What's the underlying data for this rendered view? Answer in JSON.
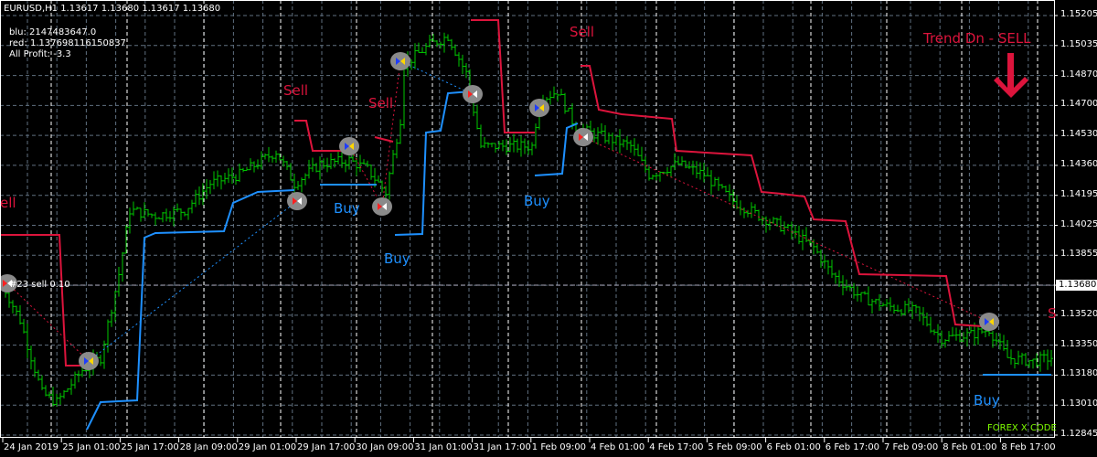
{
  "header": {
    "symbol_line": "EURUSD,H1  1.13617 1.13680 1.13617 1.13680"
  },
  "info": {
    "blu": "blu: 2147483647.0",
    "red": "red: 1.137698116150837",
    "profit": "All Profit: -3.3"
  },
  "trade_label": "#23 sell 0.10",
  "trend_label": "Trend Dn - SELL",
  "watermark": "FOREX X CODE",
  "current_price": "1.13680",
  "signals": {
    "sell": "Sell",
    "sell_cut": "ell",
    "s_cut": "S",
    "buy": "Buy"
  },
  "colors": {
    "bars": "#00c800",
    "sell_line": "#dc143c",
    "buy_line": "#1e90ff",
    "grid": "#607080"
  },
  "chart_data": {
    "type": "line",
    "title": "EURUSD,H1",
    "ylim": [
      1.12845,
      1.15205
    ],
    "yticks": [
      "1.15205",
      "1.15035",
      "1.14870",
      "1.14700",
      "1.14530",
      "1.14360",
      "1.14195",
      "1.14025",
      "1.13855",
      "1.13680",
      "1.13520",
      "1.13350",
      "1.13180",
      "1.13010",
      "1.12845"
    ],
    "xticks": [
      "24 Jan 2019",
      "25 Jan 01:00",
      "25 Jan 17:00",
      "28 Jan 09:00",
      "29 Jan 01:00",
      "29 Jan 17:00",
      "30 Jan 09:00",
      "31 Jan 01:00",
      "31 Jan 17:00",
      "1 Feb 09:00",
      "4 Feb 01:00",
      "4 Feb 17:00",
      "5 Feb 09:00",
      "6 Feb 01:00",
      "6 Feb 17:00",
      "7 Feb 09:00",
      "8 Feb 01:00",
      "8 Feb 17:00"
    ],
    "close_keypoints": [
      [
        0,
        1.137
      ],
      [
        5,
        1.1349
      ],
      [
        11,
        1.1308
      ],
      [
        15,
        1.1303
      ],
      [
        22,
        1.1321
      ],
      [
        27,
        1.1328
      ],
      [
        32,
        1.1375
      ],
      [
        35,
        1.1411
      ],
      [
        42,
        1.1408
      ],
      [
        50,
        1.1411
      ],
      [
        57,
        1.1426
      ],
      [
        65,
        1.1431
      ],
      [
        75,
        1.1444
      ],
      [
        80,
        1.1426
      ],
      [
        87,
        1.1437
      ],
      [
        95,
        1.1439
      ],
      [
        100,
        1.1434
      ],
      [
        105,
        1.1421
      ],
      [
        109,
        1.1462
      ],
      [
        110,
        1.1493
      ],
      [
        117,
        1.1504
      ],
      [
        122,
        1.1509
      ],
      [
        127,
        1.1488
      ],
      [
        131,
        1.1447
      ],
      [
        140,
        1.1447
      ],
      [
        145,
        1.1447
      ],
      [
        147,
        1.1473
      ],
      [
        152,
        1.1478
      ],
      [
        157,
        1.1457
      ],
      [
        165,
        1.1452
      ],
      [
        172,
        1.1447
      ],
      [
        177,
        1.1431
      ],
      [
        185,
        1.1437
      ],
      [
        192,
        1.1431
      ],
      [
        200,
        1.1416
      ],
      [
        207,
        1.1408
      ],
      [
        215,
        1.14
      ],
      [
        222,
        1.139
      ],
      [
        227,
        1.1375
      ],
      [
        235,
        1.1362
      ],
      [
        242,
        1.1357
      ],
      [
        250,
        1.1354
      ],
      [
        257,
        1.1339
      ],
      [
        265,
        1.1341
      ],
      [
        270,
        1.1344
      ],
      [
        275,
        1.1328
      ],
      [
        282,
        1.1326
      ],
      [
        287,
        1.1328
      ]
    ]
  }
}
